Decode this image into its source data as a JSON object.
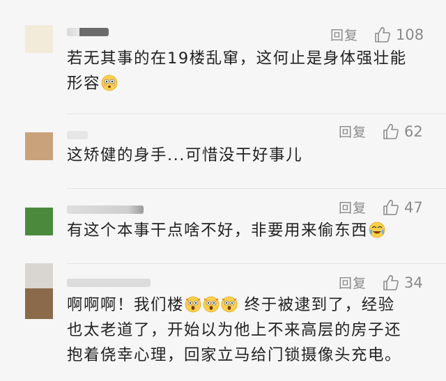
{
  "comments": [
    {
      "reply_label": "回复",
      "likes": "108",
      "text_lines": [
        "若无其事的在19楼乱窜，这何止是身体强壮能",
        "形容"
      ],
      "avatar_color": "#f3ebd9"
    },
    {
      "reply_label": "回复",
      "likes": "62",
      "text_lines": [
        "这矫健的身手...可惜没干好事儿"
      ],
      "avatar_color": "#c9a27b"
    },
    {
      "reply_label": "回复",
      "likes": "47",
      "text_lines": [
        "有这个本事干点啥不好，非要用来偷东西"
      ],
      "avatar_color": "#4b8a3c"
    },
    {
      "reply_label": "回复",
      "likes": "34",
      "text_lines": [
        "啊啊啊！我们楼",
        "终于被逮到了，经验",
        "也太老道了，开始以为他上不来高层的房子还",
        "抱着侥幸心理，回家立马给门锁摄像头充电。"
      ],
      "avatar_color": "#8a6a4a"
    }
  ],
  "icons": {
    "like": "thumbs-up-icon",
    "shocked": "flushed-face-emoji",
    "crying": "crying-laughing-emoji",
    "scream": "screaming-face-emoji"
  }
}
